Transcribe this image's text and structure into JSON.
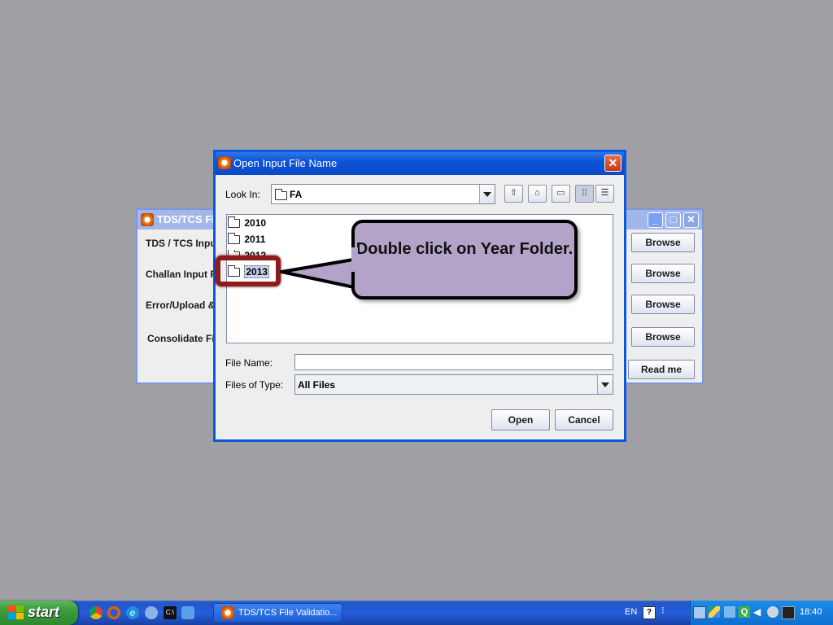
{
  "background_window": {
    "title": "TDS/TCS Fil",
    "rows": [
      {
        "label": "TDS / TCS Input",
        "button": "Browse"
      },
      {
        "label": "Challan Input F",
        "button": "Browse"
      },
      {
        "label": "Error/Upload &",
        "button": "Browse"
      },
      {
        "label": "Consolidate Fil",
        "button": "Browse"
      }
    ],
    "readme_button": "Read me"
  },
  "dialog": {
    "title": "Open Input File Name",
    "look_in_label": "Look In:",
    "look_in_value": "FA",
    "folders": [
      "2010",
      "2011",
      "2012",
      "2013"
    ],
    "selected_folder": "2013",
    "file_name_label": "File Name:",
    "file_name_value": "",
    "files_of_type_label": "Files of Type:",
    "files_of_type_value": "All Files",
    "open_button": "Open",
    "cancel_button": "Cancel",
    "toolbar_icons": [
      "up-one-level-icon",
      "home-icon",
      "new-folder-icon",
      "list-view-icon",
      "details-view-icon"
    ]
  },
  "callout": {
    "text": "Double click on Year Folder."
  },
  "taskbar": {
    "start_label": "start",
    "task_label": "TDS/TCS File Validatio...",
    "language": "EN",
    "clock": "18:40",
    "quicklaunch_icons": [
      "chrome-icon",
      "firefox-icon",
      "ie-icon",
      "network-icon",
      "cmd-icon",
      "app-icon"
    ],
    "tray_icons": [
      "network-icon",
      "drive-icon",
      "dropbox-icon",
      "q-icon",
      "volume-icon",
      "security-icon",
      "monitor-icon"
    ]
  },
  "colors": {
    "desktop": "#a09fa4",
    "titlebar": "#0c53d6",
    "callout_fill": "#b3a3c8",
    "highlight_border": "#8c1c1c"
  }
}
